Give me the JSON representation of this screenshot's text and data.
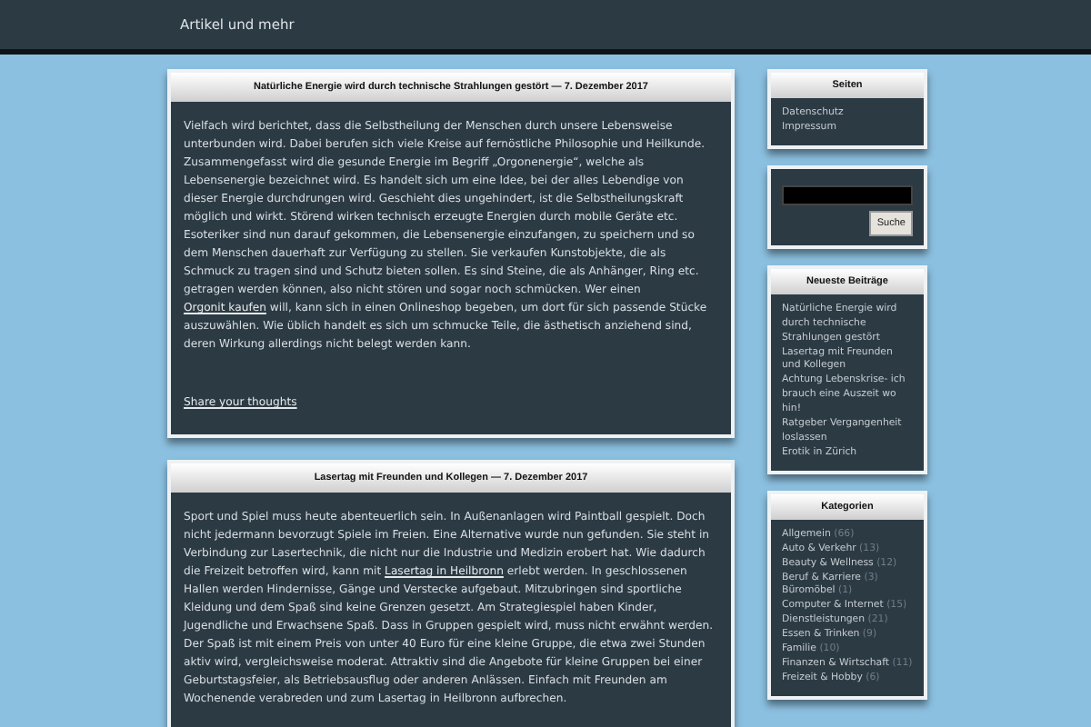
{
  "site_title": "Artikel und mehr",
  "posts": [
    {
      "title": "Natürliche Energie wird durch technische Strahlungen gestört — 7. Dezember 2017",
      "before": "Vielfach wird berichtet, dass die Selbstheilung der Menschen durch unsere Lebensweise unterbunden wird. Dabei berufen sich viele Kreise auf fernöstliche Philosophie und Heilkunde. Zusammengefasst wird die gesunde Energie im Begriff „Orgonenergie“, welche als Lebensenergie bezeichnet wird. Es handelt sich um eine Idee, bei der alles Lebendige von dieser Energie durchdrungen wird. Geschieht dies ungehindert, ist die Selbstheilungskraft möglich und wirkt. Störend wirken technisch erzeugte Energien durch mobile Geräte etc. Esoteriker sind nun darauf gekommen, die Lebensenergie einzufangen, zu speichern und so dem Menschen dauerhaft zur Verfügung zu stellen. Sie verkaufen Kunstobjekte, die als Schmuck zu tragen sind und Schutz bieten sollen. Es sind Steine, die als Anhänger, Ring etc. getragen werden können, also nicht stören und sogar noch schmücken. Wer einen ",
      "link": "Orgonit kaufen",
      "after": " will, kann sich in einen Onlineshop begeben, um dort für sich passende Stücke auszuwählen. Wie üblich handelt es sich um schmucke Teile, die ästhetisch anziehend sind, deren Wirkung allerdings nicht belegt werden kann.",
      "share": "Share your thoughts"
    },
    {
      "title": "Lasertag mit Freunden und Kollegen — 7. Dezember 2017",
      "before": "Sport und Spiel muss heute abenteuerlich sein. In Außenanlagen wird Paintball gespielt. Doch nicht jedermann bevorzugt Spiele im Freien. Eine Alternative wurde nun gefunden. Sie steht in Verbindung zur Lasertechnik, die nicht nur die Industrie und Medizin erobert hat. Wie dadurch die Freizeit betroffen wird, kann mit ",
      "link": "Lasertag in Heilbronn",
      "after": " erlebt werden.  In geschlossenen Hallen werden Hindernisse, Gänge und Verstecke aufgebaut. Mitzubringen sind sportliche Kleidung und dem Spaß sind keine Grenzen gesetzt. Am Strategiespiel haben Kinder, Jugendliche und Erwachsene Spaß. Dass in Gruppen gespielt wird, muss nicht erwähnt werden. Der Spaß ist mit einem Preis von unter 40 Euro für eine kleine Gruppe, die etwa zwei Stunden aktiv wird, vergleichsweise moderat. Attraktiv sind die Angebote für kleine Gruppen bei einer Geburtstagsfeier, als Betriebsausflug oder anderen Anlässen. Einfach mit Freunden am Wochenende verabreden und zum Lasertag in Heilbronn aufbrechen."
    }
  ],
  "widgets": [
    {
      "kind": "links",
      "title": "Seiten",
      "items": [
        {
          "label": "Datenschutz"
        },
        {
          "label": "Impressum"
        }
      ]
    },
    {
      "kind": "search",
      "button": "Suche"
    },
    {
      "kind": "links",
      "title": "Neueste Beiträge",
      "items": [
        {
          "label": "Natürliche Energie wird durch technische Strahlungen gestört"
        },
        {
          "label": "Lasertag mit Freunden und Kollegen"
        },
        {
          "label": "Achtung Lebenskrise- ich brauch eine Auszeit wo hin!"
        },
        {
          "label": "Ratgeber Vergangenheit loslassen"
        },
        {
          "label": "Erotik in Zürich"
        }
      ]
    },
    {
      "kind": "links",
      "title": "Kategorien",
      "items": [
        {
          "label": "Allgemein",
          "count": "(66)"
        },
        {
          "label": "Auto & Verkehr",
          "count": "(13)"
        },
        {
          "label": "Beauty & Wellness",
          "count": "(12)"
        },
        {
          "label": "Beruf & Karriere",
          "count": "(3)"
        },
        {
          "label": "Büromöbel",
          "count": "(1)"
        },
        {
          "label": "Computer & Internet",
          "count": "(15)"
        },
        {
          "label": "Dienstleistungen",
          "count": "(21)"
        },
        {
          "label": "Essen & Trinken",
          "count": "(9)"
        },
        {
          "label": "Familie",
          "count": "(10)"
        },
        {
          "label": "Finanzen & Wirtschaft",
          "count": "(11)"
        },
        {
          "label": "Freizeit & Hobby",
          "count": "(6)"
        }
      ]
    }
  ]
}
